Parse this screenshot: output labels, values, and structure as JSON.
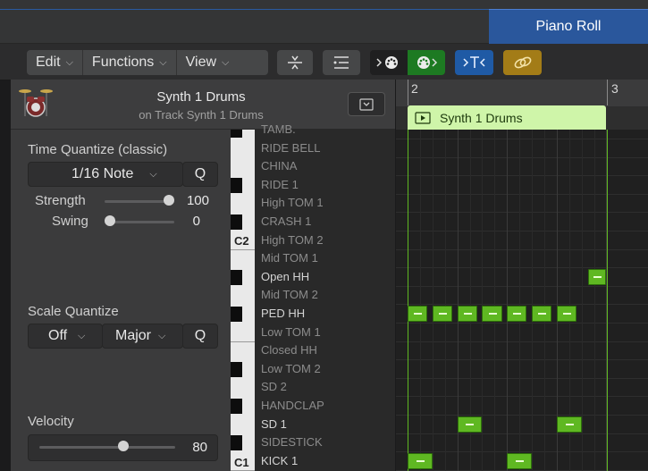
{
  "window": {
    "tab_title": "Piano Roll"
  },
  "toolbar": {
    "edit": "Edit",
    "functions": "Functions",
    "view": "View",
    "caret": "⌵"
  },
  "track": {
    "name": "Synth 1 Drums",
    "subtitle": "on Track Synth 1 Drums"
  },
  "time_quantize": {
    "title": "Time Quantize (classic)",
    "value": "1/16 Note",
    "q_label": "Q",
    "strength_label": "Strength",
    "strength_value": "100",
    "strength_level": 1.0,
    "swing_label": "Swing",
    "swing_value": "0",
    "swing_level": 0.0
  },
  "scale_quantize": {
    "title": "Scale Quantize",
    "root": "Off",
    "scale": "Major",
    "q_label": "Q"
  },
  "velocity": {
    "title": "Velocity",
    "value": "80",
    "level": 0.63
  },
  "piano": {
    "c2": "C2",
    "c1": "C1"
  },
  "ruler": {
    "bar2": "2",
    "bar3": "3"
  },
  "region": {
    "name": "Synth 1 Drums"
  },
  "drum_names": [
    "TAMB.",
    "RIDE BELL",
    "CHINA",
    "RIDE 1",
    "High TOM 1",
    "CRASH 1",
    "High TOM 2",
    "Mid TOM 1",
    "Open HH",
    "Mid TOM 2",
    "PED HH",
    "Low TOM 1",
    "Closed HH",
    "Low TOM 2",
    "SD 2",
    "HANDCLAP",
    "SD 1",
    "SIDESTICK",
    "KICK 1"
  ],
  "colors": {
    "region": "#cff5a9",
    "note": "#5fb822",
    "tab": "#2a579c"
  }
}
